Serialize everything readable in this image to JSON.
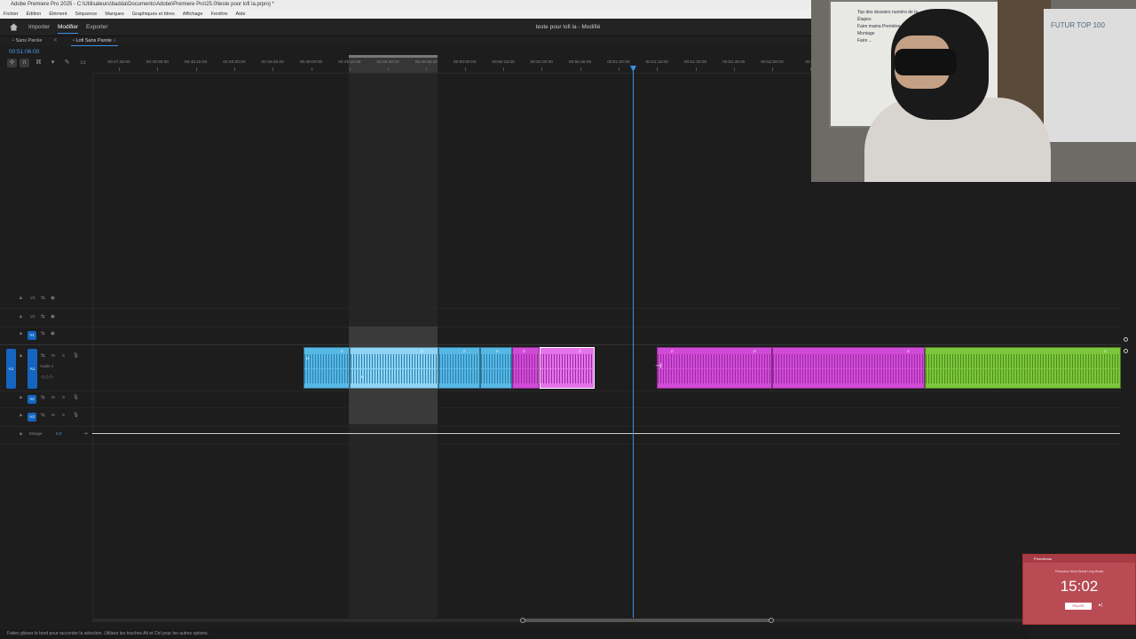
{
  "app": {
    "window_title": "Adobe Premiere Pro 2025 - C:\\Utilisateurs\\badda\\Documents\\Adobe\\Premiere Pro\\25.0\\teste pour lofi la.prproj *",
    "menu": [
      "Fichier",
      "Édition",
      "Élément",
      "Séquence",
      "Marques",
      "Graphiques et titres",
      "Affichage",
      "Fenêtre",
      "Aide"
    ],
    "workspaces": [
      "Importer",
      "Modifier",
      "Exporter"
    ],
    "active_workspace": "Modifier",
    "project_title": "teste pour lofi la - Modifié"
  },
  "sequence_tabs": [
    "Sans Parole",
    "Lofi Sans Parole"
  ],
  "active_sequence": "Lofi Sans Parole",
  "timecode": "00:51:06:00",
  "ruler_ticks": [
    "00:47:45:00",
    "00:48:00:00",
    "00:48:15:00",
    "00:48:30:00",
    "00:48:45:00",
    "00:49:00:00",
    "00:49:15:00",
    "00:49:30:00",
    "00:49:45:00",
    "00:50:00:00",
    "00:50:15:00",
    "00:50:30:00",
    "00:50:45:00",
    "00:51:00:00",
    "00:51:15:00",
    "00:51:30:00",
    "00:51:45:00",
    "00:52:00:00",
    "00:52"
  ],
  "tracks": {
    "video": [
      {
        "label": "V3"
      },
      {
        "label": "V2"
      },
      {
        "label": "V1"
      }
    ],
    "audio": [
      {
        "label": "A1",
        "name": "Audio 1"
      },
      {
        "label": "A2"
      },
      {
        "label": "A3"
      }
    ],
    "mix": {
      "label": "Mixage",
      "value": "0,0"
    }
  },
  "track_buttons": {
    "mute": "M",
    "solo": "S"
  },
  "status_text": "Faites glisser le bord pour raccorder la sélection. Utilisez les touches Alt et Ctrl pour les autres options.",
  "timer": {
    "header": "Pomofocus",
    "modes": "Pomodoro   Short Break   Long Break",
    "time": "15:02",
    "button": "PAUSE"
  },
  "webcam": {
    "whiteboard_heading": "Top des dossiers numéro de la ...",
    "whiteboard_lines": [
      "Étapes",
      "Faire mama Première",
      "Montage",
      "Faire ..."
    ],
    "sign": "FUTUR TOP 100"
  },
  "colors": {
    "accent": "#3d8ee8",
    "clip_blue": "#56b8e4",
    "clip_magenta": "#d24bd8",
    "clip_green": "#7cc63c"
  }
}
